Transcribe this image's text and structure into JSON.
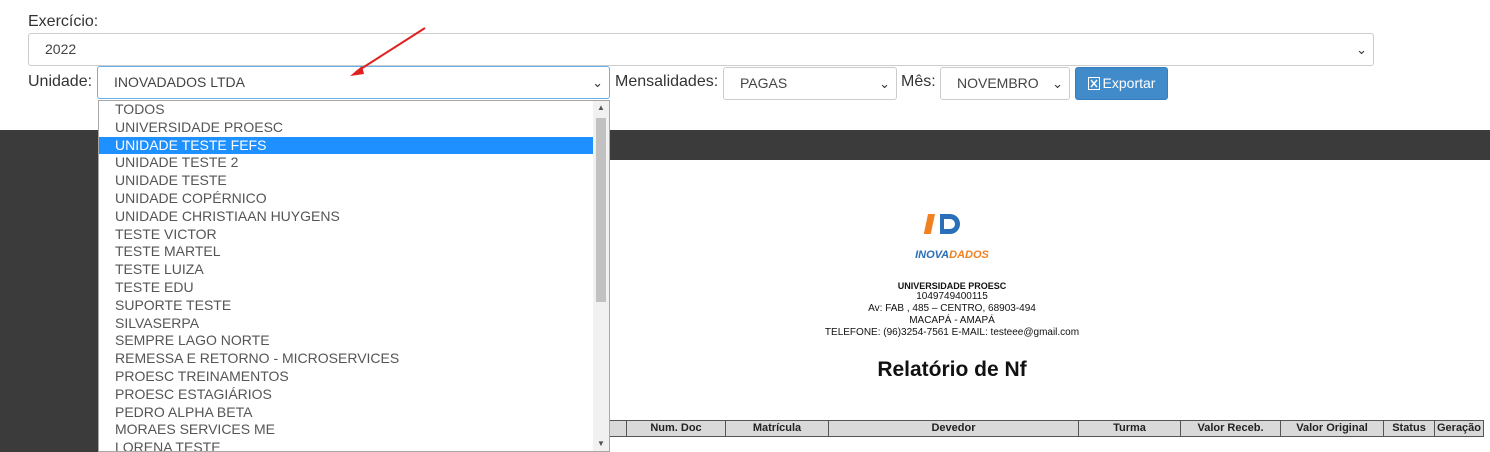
{
  "filters": {
    "exercicio_label": "Exercício:",
    "exercicio_value": "2022",
    "unidade_label": "Unidade:",
    "unidade_value": "INOVADADOS LTDA",
    "mensalidades_label": "Mensalidades:",
    "mensalidades_value": "PAGAS",
    "mes_label": "Mês:",
    "mes_value": "NOVEMBRO",
    "export_label": "Exportar"
  },
  "dropdown": {
    "options": [
      "TODOS",
      "UNIVERSIDADE PROESC",
      "UNIDADE TESTE FEFS",
      "UNIDADE TESTE 2",
      "UNIDADE TESTE",
      "UNIDADE COPÉRNICO",
      "UNIDADE CHRISTIAAN HUYGENS",
      "TESTE VICTOR",
      "TESTE MARTEL",
      "TESTE LUIZA",
      "TESTE EDU",
      "SUPORTE TESTE",
      "SILVASERPA",
      "SEMPRE LAGO NORTE",
      "REMESSA E RETORNO - MICROSERVICES",
      "PROESC TREINAMENTOS",
      "PROESC ESTAGIÁRIOS",
      "PEDRO ALPHA BETA",
      "MORAES SERVICES ME",
      "LORENA TESTE"
    ],
    "highlighted": "UNIDADE TESTE FEFS"
  },
  "report": {
    "logo_text": "INOVADADOS",
    "company_lines": [
      "UNIVERSIDADE PROESC",
      "1049749400115",
      "Av: FAB , 485 – CENTRO, 68903-494",
      "MACAPÁ - AMAPÁ",
      "TELEFONE: (96)3254-7561 E-MAIL: testeee@gmail.com"
    ],
    "title": "Relatório de Nf",
    "columns": [
      "Num. Doc",
      "Matrícula",
      "Devedor",
      "Turma",
      "Valor Receb.",
      "Valor Original",
      "Status",
      "Geração"
    ]
  },
  "colors": {
    "accent": "#428bca",
    "highlight": "#1e90ff",
    "arrow": "#e02020",
    "backdrop": "#3b3b3b"
  }
}
